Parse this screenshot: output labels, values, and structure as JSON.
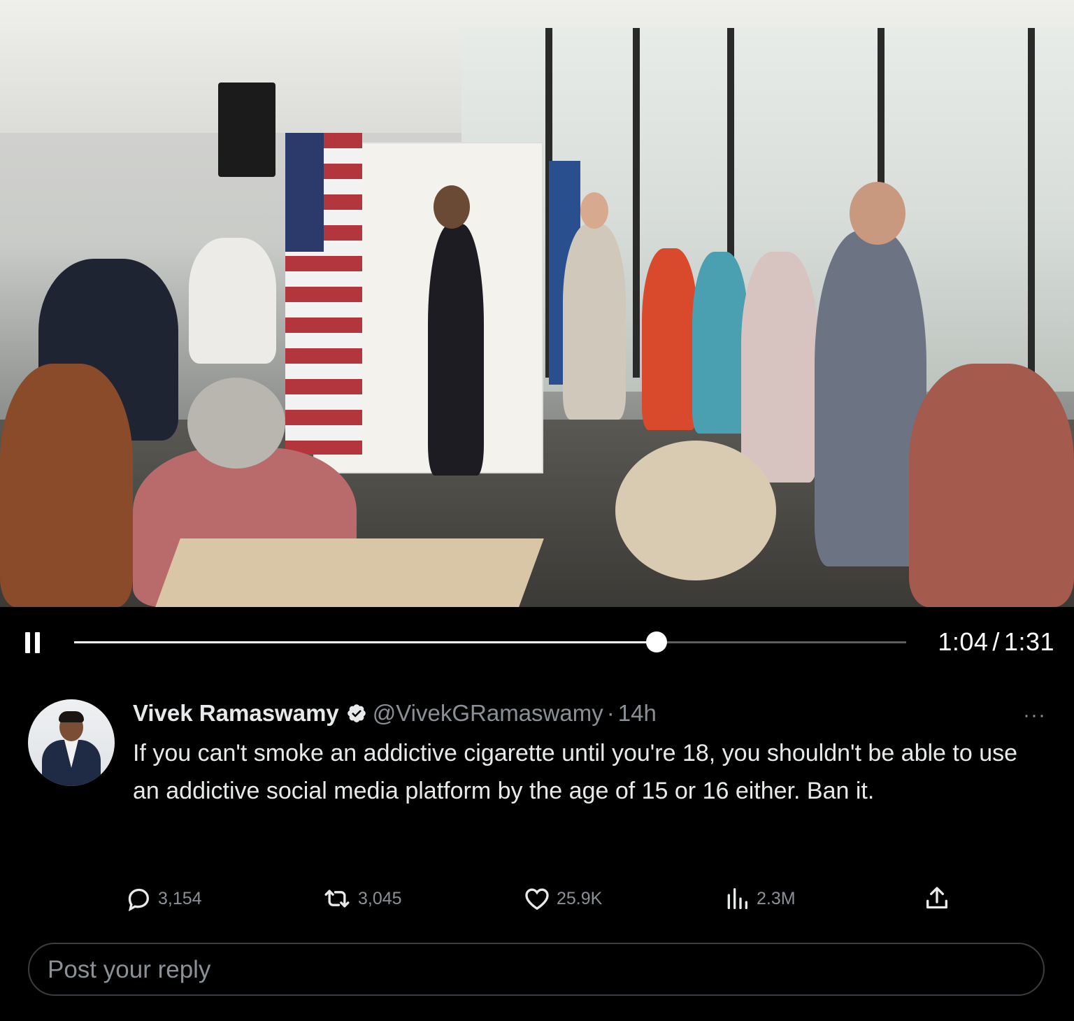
{
  "video": {
    "is_playing": true,
    "current_time": "1:04",
    "separator": "/",
    "duration": "1:31",
    "progress": 0.7
  },
  "post": {
    "author_name": "Vivek Ramaswamy",
    "verified": true,
    "handle": "@VivekGRamaswamy",
    "dot": "·",
    "time_ago": "14h",
    "more_label": "···",
    "text": "If you can't smoke an addictive cigarette until you're 18, you shouldn't be able to use an addictive social media platform by the age of 15 or 16 either. Ban it.",
    "stats": {
      "replies": "3,154",
      "reposts": "3,045",
      "likes": "25.9K",
      "views": "2.3M"
    }
  },
  "reply": {
    "placeholder": "Post your reply"
  },
  "icons": {
    "pause": "pause-icon",
    "verified": "verified-badge-icon",
    "reply": "reply-icon",
    "repost": "repost-icon",
    "like": "heart-icon",
    "views": "views-bar-icon",
    "share": "share-icon"
  },
  "colors": {
    "background": "#000000",
    "text_primary": "#e7e9ea",
    "text_secondary": "#8b9096",
    "progress_fill": "#ffffff",
    "progress_track": "#5b5f63"
  }
}
